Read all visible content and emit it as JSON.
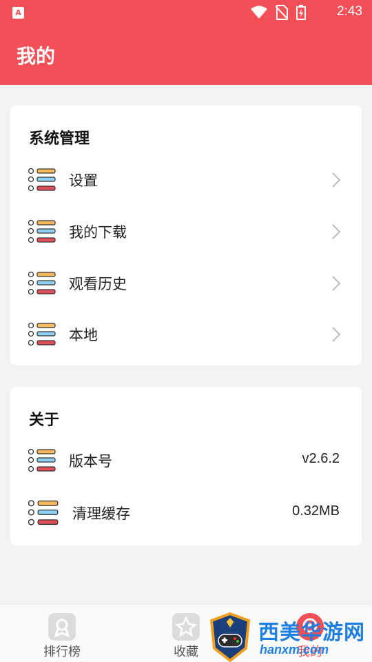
{
  "status_bar": {
    "app_badge": "A",
    "time": "2:43",
    "icons": [
      "wifi-icon",
      "no-sim-icon",
      "battery-charging-icon"
    ]
  },
  "app_bar": {
    "title": "我的"
  },
  "system_section": {
    "title": "系统管理",
    "items": [
      {
        "label": "设置",
        "icon": "list-icon",
        "trailing": "chevron-right-icon"
      },
      {
        "label": "我的下载",
        "icon": "list-icon",
        "trailing": "chevron-right-icon"
      },
      {
        "label": "观看历史",
        "icon": "list-icon",
        "trailing": "chevron-right-icon"
      },
      {
        "label": "本地",
        "icon": "list-icon",
        "trailing": "chevron-right-icon"
      }
    ]
  },
  "about_section": {
    "title": "关于",
    "items": [
      {
        "label": "版本号",
        "value": "v2.6.2",
        "icon": "list-icon"
      },
      {
        "label": "清理缓存",
        "value": "0.32MB",
        "icon": "list-icon"
      }
    ]
  },
  "bottom_nav": {
    "items": [
      {
        "label": "排行榜",
        "icon": "ranking-icon"
      },
      {
        "label": "收藏",
        "icon": "star-icon"
      },
      {
        "label": "我的",
        "icon": "profile-icon",
        "active": true
      }
    ]
  },
  "watermark": {
    "text": "西美华游网",
    "url": "hanxm.com"
  },
  "colors": {
    "accent": "#f25056",
    "background": "#f3f3f3",
    "card": "#ffffff",
    "icon_yellow": "#f5b85a",
    "icon_blue": "#5aaee6",
    "icon_red": "#e14f5a"
  }
}
